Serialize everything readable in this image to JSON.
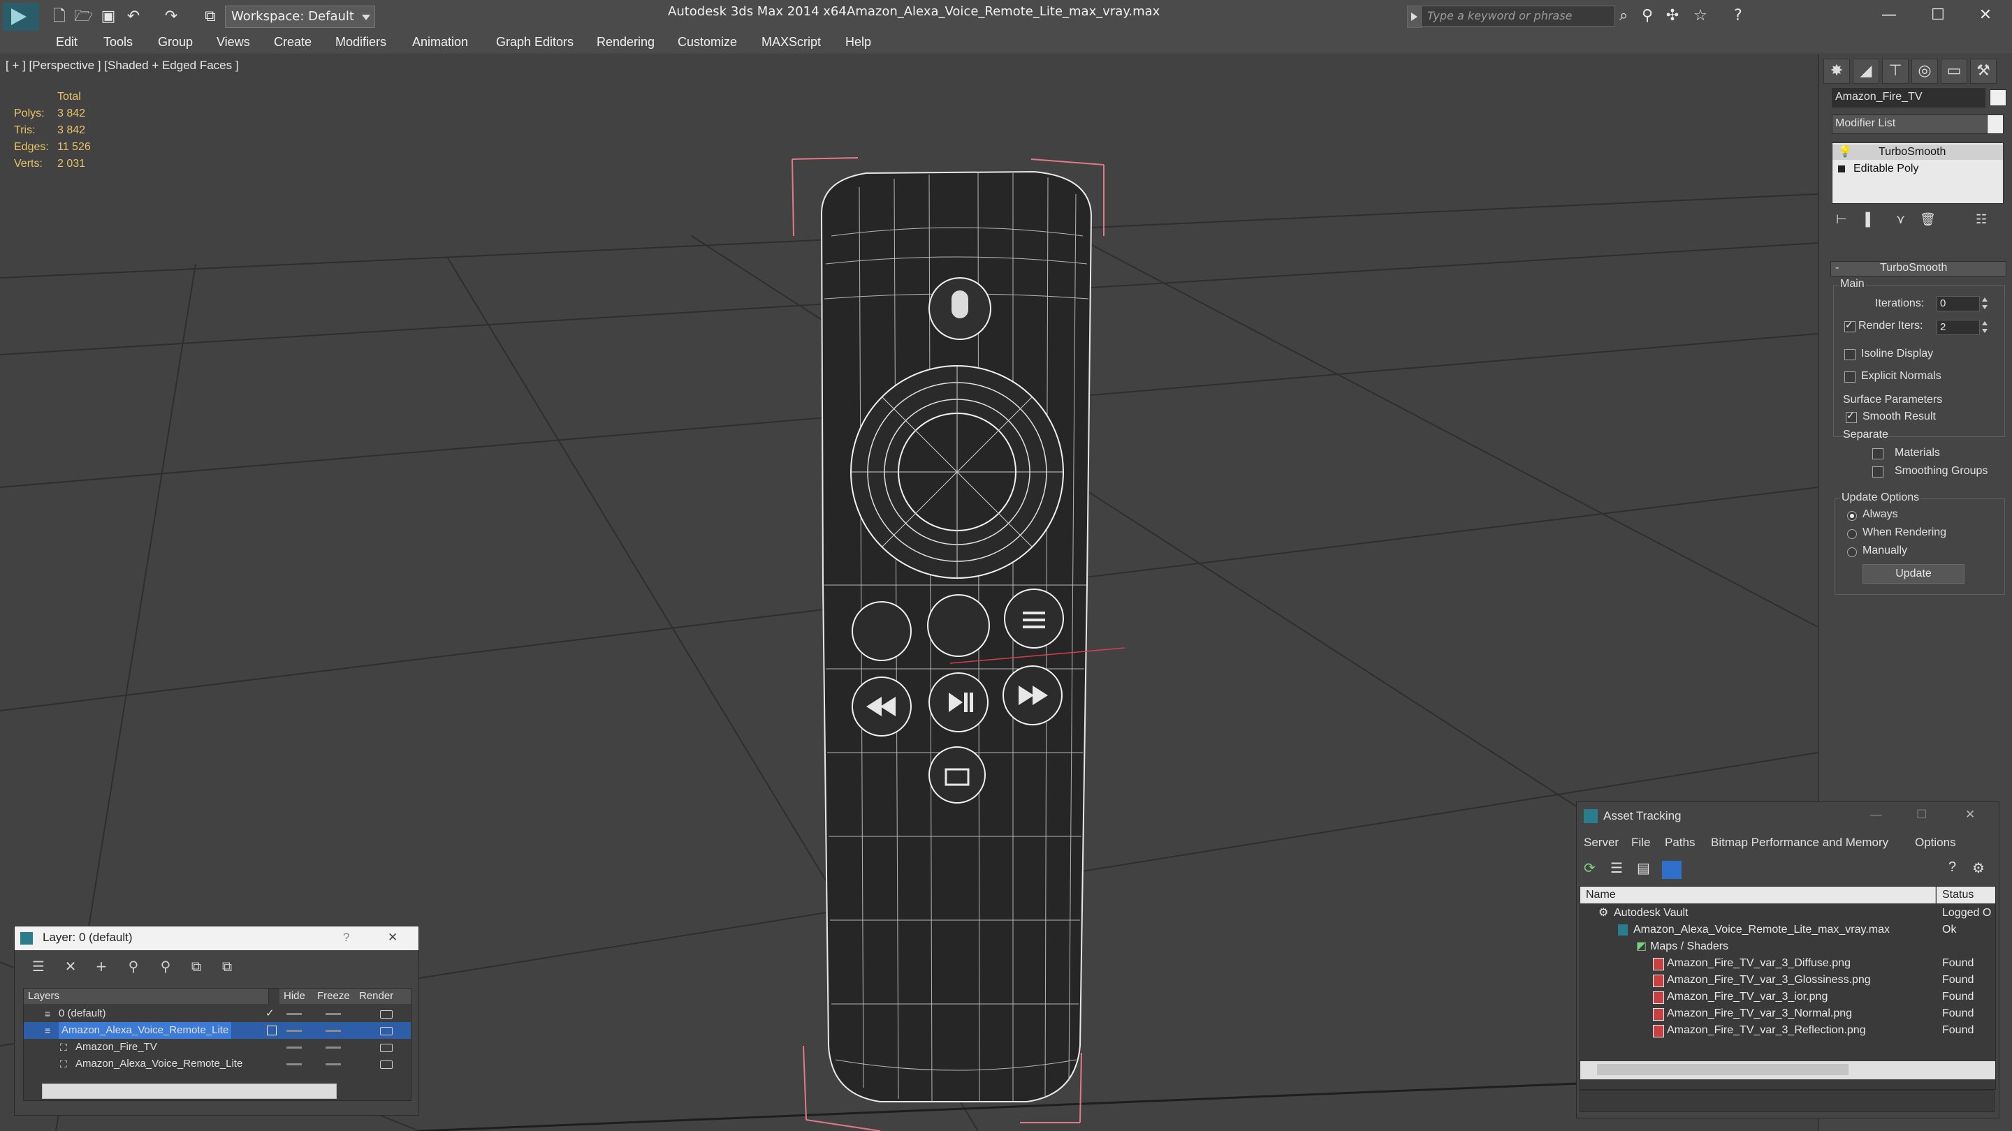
{
  "titlebar": {
    "app_title": "Autodesk 3ds Max  2014 x64",
    "file_title": "Amazon_Alexa_Voice_Remote_Lite_max_vray.max",
    "workspace": "Workspace: Default",
    "search_placeholder": "Type a keyword or phrase",
    "minimize": "—",
    "maximize": "☐",
    "close": "✕"
  },
  "menu": {
    "items": [
      "Edit",
      "Tools",
      "Group",
      "Views",
      "Create",
      "Modifiers",
      "Animation",
      "Graph Editors",
      "Rendering",
      "Customize",
      "MAXScript",
      "Help"
    ]
  },
  "viewport": {
    "label": "[ + ] [Perspective ] [Shaded + Edged Faces ]",
    "stats": {
      "header": "Total",
      "rows": [
        {
          "label": "Polys:",
          "value": "3 842"
        },
        {
          "label": "Tris:",
          "value": "3 842"
        },
        {
          "label": "Edges:",
          "value": "11 526"
        },
        {
          "label": "Verts:",
          "value": "2 031"
        }
      ]
    }
  },
  "command_panel": {
    "object_name": "Amazon_Fire_TV",
    "modifier_list": "Modifier List",
    "stack": [
      "TurboSmooth",
      "Editable Poly"
    ],
    "rollout_title": "TurboSmooth",
    "main_label": "Main",
    "iterations_label": "Iterations:",
    "iterations_value": "0",
    "render_iters_label": "Render Iters:",
    "render_iters_value": "2",
    "isoline": "Isoline Display",
    "explicit_normals": "Explicit Normals",
    "surface_params": "Surface Parameters",
    "smooth_result": "Smooth Result",
    "separate": "Separate",
    "materials": "Materials",
    "smoothing_groups": "Smoothing Groups",
    "update_options": "Update Options",
    "always": "Always",
    "when_rendering": "When Rendering",
    "manually": "Manually",
    "update_button": "Update"
  },
  "layer_dialog": {
    "title": "Layer: 0 (default)",
    "help": "?",
    "close": "✕",
    "columns": [
      "Layers",
      "Hide",
      "Freeze",
      "Render"
    ],
    "rows": [
      {
        "name": "0 (default)"
      },
      {
        "name": "Amazon_Alexa_Voice_Remote_Lite"
      },
      {
        "name": "Amazon_Fire_TV"
      },
      {
        "name": "Amazon_Alexa_Voice_Remote_Lite"
      }
    ]
  },
  "asset_dialog": {
    "title": "Asset Tracking",
    "menu": [
      "Server",
      "File",
      "Paths",
      "Bitmap Performance and Memory",
      "Options"
    ],
    "columns": [
      "Name",
      "Status"
    ],
    "rows": [
      {
        "name": "Autodesk Vault",
        "status": "Logged O"
      },
      {
        "name": "Amazon_Alexa_Voice_Remote_Lite_max_vray.max",
        "status": "Ok"
      },
      {
        "name": "Maps / Shaders",
        "status": ""
      },
      {
        "name": "Amazon_Fire_TV_var_3_Diffuse.png",
        "status": "Found"
      },
      {
        "name": "Amazon_Fire_TV_var_3_Glossiness.png",
        "status": "Found"
      },
      {
        "name": "Amazon_Fire_TV_var_3_ior.png",
        "status": "Found"
      },
      {
        "name": "Amazon_Fire_TV_var_3_Normal.png",
        "status": "Found"
      },
      {
        "name": "Amazon_Fire_TV_var_3_Reflection.png",
        "status": "Found"
      }
    ]
  }
}
